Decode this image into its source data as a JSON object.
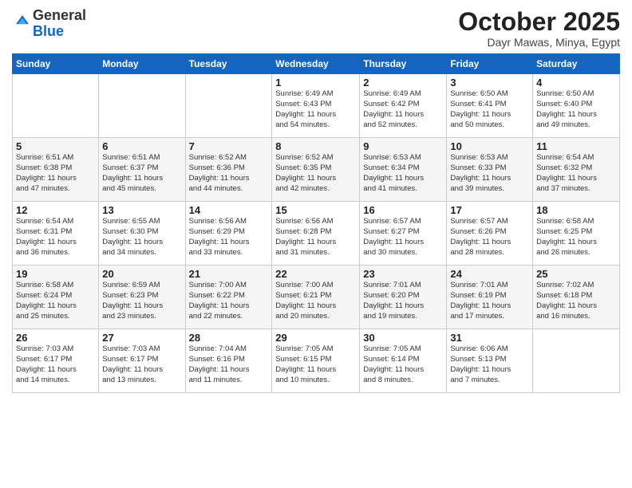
{
  "logo": {
    "general": "General",
    "blue": "Blue"
  },
  "header": {
    "month": "October 2025",
    "location": "Dayr Mawas, Minya, Egypt"
  },
  "weekdays": [
    "Sunday",
    "Monday",
    "Tuesday",
    "Wednesday",
    "Thursday",
    "Friday",
    "Saturday"
  ],
  "weeks": [
    [
      {
        "day": "",
        "info": ""
      },
      {
        "day": "",
        "info": ""
      },
      {
        "day": "",
        "info": ""
      },
      {
        "day": "1",
        "info": "Sunrise: 6:49 AM\nSunset: 6:43 PM\nDaylight: 11 hours\nand 54 minutes."
      },
      {
        "day": "2",
        "info": "Sunrise: 6:49 AM\nSunset: 6:42 PM\nDaylight: 11 hours\nand 52 minutes."
      },
      {
        "day": "3",
        "info": "Sunrise: 6:50 AM\nSunset: 6:41 PM\nDaylight: 11 hours\nand 50 minutes."
      },
      {
        "day": "4",
        "info": "Sunrise: 6:50 AM\nSunset: 6:40 PM\nDaylight: 11 hours\nand 49 minutes."
      }
    ],
    [
      {
        "day": "5",
        "info": "Sunrise: 6:51 AM\nSunset: 6:38 PM\nDaylight: 11 hours\nand 47 minutes."
      },
      {
        "day": "6",
        "info": "Sunrise: 6:51 AM\nSunset: 6:37 PM\nDaylight: 11 hours\nand 45 minutes."
      },
      {
        "day": "7",
        "info": "Sunrise: 6:52 AM\nSunset: 6:36 PM\nDaylight: 11 hours\nand 44 minutes."
      },
      {
        "day": "8",
        "info": "Sunrise: 6:52 AM\nSunset: 6:35 PM\nDaylight: 11 hours\nand 42 minutes."
      },
      {
        "day": "9",
        "info": "Sunrise: 6:53 AM\nSunset: 6:34 PM\nDaylight: 11 hours\nand 41 minutes."
      },
      {
        "day": "10",
        "info": "Sunrise: 6:53 AM\nSunset: 6:33 PM\nDaylight: 11 hours\nand 39 minutes."
      },
      {
        "day": "11",
        "info": "Sunrise: 6:54 AM\nSunset: 6:32 PM\nDaylight: 11 hours\nand 37 minutes."
      }
    ],
    [
      {
        "day": "12",
        "info": "Sunrise: 6:54 AM\nSunset: 6:31 PM\nDaylight: 11 hours\nand 36 minutes."
      },
      {
        "day": "13",
        "info": "Sunrise: 6:55 AM\nSunset: 6:30 PM\nDaylight: 11 hours\nand 34 minutes."
      },
      {
        "day": "14",
        "info": "Sunrise: 6:56 AM\nSunset: 6:29 PM\nDaylight: 11 hours\nand 33 minutes."
      },
      {
        "day": "15",
        "info": "Sunrise: 6:56 AM\nSunset: 6:28 PM\nDaylight: 11 hours\nand 31 minutes."
      },
      {
        "day": "16",
        "info": "Sunrise: 6:57 AM\nSunset: 6:27 PM\nDaylight: 11 hours\nand 30 minutes."
      },
      {
        "day": "17",
        "info": "Sunrise: 6:57 AM\nSunset: 6:26 PM\nDaylight: 11 hours\nand 28 minutes."
      },
      {
        "day": "18",
        "info": "Sunrise: 6:58 AM\nSunset: 6:25 PM\nDaylight: 11 hours\nand 26 minutes."
      }
    ],
    [
      {
        "day": "19",
        "info": "Sunrise: 6:58 AM\nSunset: 6:24 PM\nDaylight: 11 hours\nand 25 minutes."
      },
      {
        "day": "20",
        "info": "Sunrise: 6:59 AM\nSunset: 6:23 PM\nDaylight: 11 hours\nand 23 minutes."
      },
      {
        "day": "21",
        "info": "Sunrise: 7:00 AM\nSunset: 6:22 PM\nDaylight: 11 hours\nand 22 minutes."
      },
      {
        "day": "22",
        "info": "Sunrise: 7:00 AM\nSunset: 6:21 PM\nDaylight: 11 hours\nand 20 minutes."
      },
      {
        "day": "23",
        "info": "Sunrise: 7:01 AM\nSunset: 6:20 PM\nDaylight: 11 hours\nand 19 minutes."
      },
      {
        "day": "24",
        "info": "Sunrise: 7:01 AM\nSunset: 6:19 PM\nDaylight: 11 hours\nand 17 minutes."
      },
      {
        "day": "25",
        "info": "Sunrise: 7:02 AM\nSunset: 6:18 PM\nDaylight: 11 hours\nand 16 minutes."
      }
    ],
    [
      {
        "day": "26",
        "info": "Sunrise: 7:03 AM\nSunset: 6:17 PM\nDaylight: 11 hours\nand 14 minutes."
      },
      {
        "day": "27",
        "info": "Sunrise: 7:03 AM\nSunset: 6:17 PM\nDaylight: 11 hours\nand 13 minutes."
      },
      {
        "day": "28",
        "info": "Sunrise: 7:04 AM\nSunset: 6:16 PM\nDaylight: 11 hours\nand 11 minutes."
      },
      {
        "day": "29",
        "info": "Sunrise: 7:05 AM\nSunset: 6:15 PM\nDaylight: 11 hours\nand 10 minutes."
      },
      {
        "day": "30",
        "info": "Sunrise: 7:05 AM\nSunset: 6:14 PM\nDaylight: 11 hours\nand 8 minutes."
      },
      {
        "day": "31",
        "info": "Sunrise: 6:06 AM\nSunset: 5:13 PM\nDaylight: 11 hours\nand 7 minutes."
      },
      {
        "day": "",
        "info": ""
      }
    ]
  ]
}
